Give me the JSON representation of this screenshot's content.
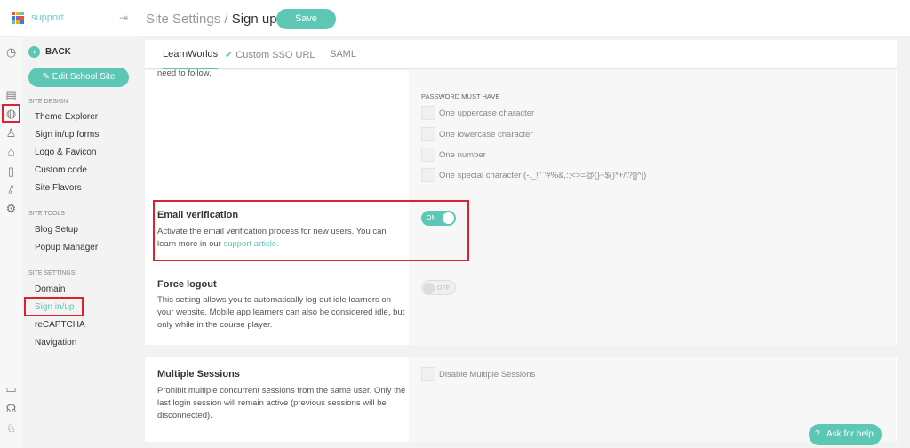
{
  "header": {
    "brand": "support",
    "title_prefix": "Site Settings / ",
    "title_page": "Sign up",
    "save_label": "Save"
  },
  "sidebar": {
    "back": "BACK",
    "edit_site": "Edit School Site",
    "site_design": "SITE DESIGN",
    "design_items": [
      "Theme Explorer",
      "Sign in/up forms",
      "Logo & Favicon",
      "Custom code",
      "Site Flavors"
    ],
    "site_tools": "SITE TOOLS",
    "tool_items": [
      "Blog Setup",
      "Popup Manager"
    ],
    "site_settings": "SITE SETTINGS",
    "setting_items": [
      "Domain",
      "Sign in/up",
      "reCAPTCHA",
      "Navigation"
    ]
  },
  "tabs": [
    "LearnWorlds",
    "Custom SSO URL",
    "SAML"
  ],
  "password": {
    "intro_tail": "need to follow.",
    "heading": "PASSWORD MUST HAVE",
    "options": [
      "One uppercase character",
      "One lowercase character",
      "One number",
      "One special character (-._!\"`'#%&,:;<>=@{}~$()*+/\\?[]^|)"
    ]
  },
  "email_verification": {
    "title": "Email verification",
    "desc": "Activate the email verification process for new users. You can learn more in our ",
    "link": "support article.",
    "toggle": "ON"
  },
  "force_logout": {
    "title": "Force logout",
    "desc": "This setting allows you to automatically log out idle learners on your website. Mobile app learners can also be considered idle, but only while in the course player.",
    "toggle": "OFF"
  },
  "multiple_sessions": {
    "title": "Multiple Sessions",
    "desc": "Prohibit multiple concurrent sessions from the same user. Only the last login session will remain active (previous sessions will be disconnected).",
    "option": "Disable Multiple Sessions"
  },
  "help": "Ask for help",
  "colors": {
    "accent": "#5cc7b4",
    "highlight": "#d9232e"
  }
}
